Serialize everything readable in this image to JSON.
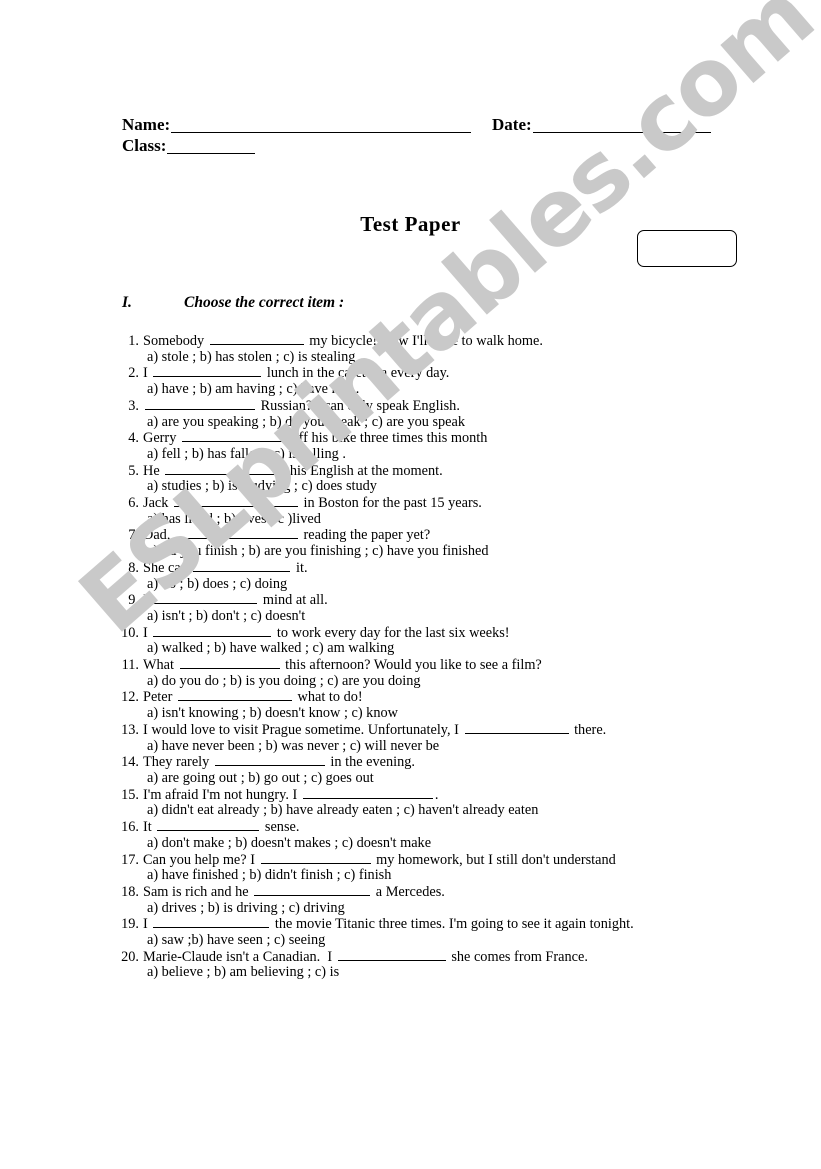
{
  "watermark": {
    "text": "ESLprintables.com",
    "color": "#c9c9c9"
  },
  "header": {
    "name_label": "Name:",
    "class_label": "Class:",
    "date_label": "Date:",
    "name_value": "",
    "class_value": "",
    "date_value": ""
  },
  "title": "Test  Paper",
  "score_box": {
    "value": ""
  },
  "section": {
    "number": "I.",
    "heading": "Choose the correct item :"
  },
  "questions": [
    {
      "num": "1.",
      "pre": "Somebody",
      "blank": 94,
      "post": "my bicycle! Now I'll have to walk home.",
      "options": "a) stole ; b) has stolen ; c) is stealing ."
    },
    {
      "num": "2.",
      "pre": "I",
      "blank": 108,
      "post": "lunch in the cafeteria every day.",
      "options": "a) have ; b) am having ; c) have had ."
    },
    {
      "num": "3.",
      "pre": "",
      "blank": 110,
      "post": "Russian? I can only speak English.",
      "options": "a) are you speaking ; b) do you speak ; c) are you speak"
    },
    {
      "num": "4.",
      "pre": "Gerry",
      "blank": 104,
      "post": "off his bike three times this month",
      "options": "a) fell ; b) has fallen ; c) is falling ."
    },
    {
      "num": "5.",
      "pre": "He",
      "blank": 119,
      "post": "his English at the moment.",
      "options": "a) studies ; b) is studying ; c) does study"
    },
    {
      "num": "6.",
      "pre": "Jack",
      "blank": 124,
      "post": "in Boston for the past 15 years.",
      "options": "a) has lived ; b) lives ; c )lived"
    },
    {
      "num": "7.",
      "pre": "Dad,",
      "blank": 122,
      "post": "reading the paper yet?",
      "options": "a)did you finish ; b) are you finishing ; c) have you finished"
    },
    {
      "num": "8.",
      "pre": "She can",
      "blank": 97,
      "post": "it.",
      "options": "a) do ; b) does ; c) doing"
    },
    {
      "num": "9.",
      "pre": "I",
      "blank": 104,
      "post": "mind at all.",
      "options": "a) isn't ; b) don't ; c) doesn't"
    },
    {
      "num": "10.",
      "pre": "I",
      "blank": 118,
      "post": "to work every day for the last six weeks!",
      "options": "a) walked ; b) have walked ; c) am walking"
    },
    {
      "num": "11.",
      "pre": "What",
      "blank": 100,
      "post": "this afternoon? Would you like to see a film?",
      "options": "a) do you do ; b) is you doing ; c) are you doing"
    },
    {
      "num": "12.",
      "pre": "Peter",
      "blank": 114,
      "post": "what to do!",
      "options": "a) isn't knowing ; b) doesn't know ; c) know"
    },
    {
      "num": "13.",
      "pre": "I would love to visit Prague sometime. Unfortunately, I",
      "blank": 104,
      "post": "there.",
      "options": "a) have never been ; b) was never ; c) will never be"
    },
    {
      "num": "14.",
      "pre": "They rarely",
      "blank": 110,
      "post": "in the evening.",
      "options": "a) are going out ;  b) go out ; c) goes out"
    },
    {
      "num": "15.",
      "pre": "I'm afraid I'm not hungry. I",
      "blank": 130,
      "post": ".",
      "options": "a) didn't eat already ; b) have already eaten ; c) haven't already eaten"
    },
    {
      "num": "16.",
      "pre": "It",
      "blank": 102,
      "post": "sense.",
      "options": "a) don't make ; b) doesn't makes ; c) doesn't make"
    },
    {
      "num": "17.",
      "pre": "Can you help me? I",
      "blank": 110,
      "post": "my homework, but I still don't understand",
      "options": "a) have finished ; b) didn't finish ; c) finish"
    },
    {
      "num": "18.",
      "pre": "Sam is rich and he",
      "blank": 116,
      "post": "a Mercedes.",
      "options": "a) drives ; b) is driving ; c) driving"
    },
    {
      "num": "19.",
      "pre": "I",
      "blank": 116,
      "post": "the movie Titanic three times. I'm going to see it again tonight.",
      "options": "a) saw ;b) have seen ; c) seeing"
    },
    {
      "num": "20.",
      "pre": "Marie-Claude isn't a Canadian.  I",
      "blank": 108,
      "post": "she comes from France.",
      "options": "a) believe ; b) am believing ; c) is"
    }
  ]
}
